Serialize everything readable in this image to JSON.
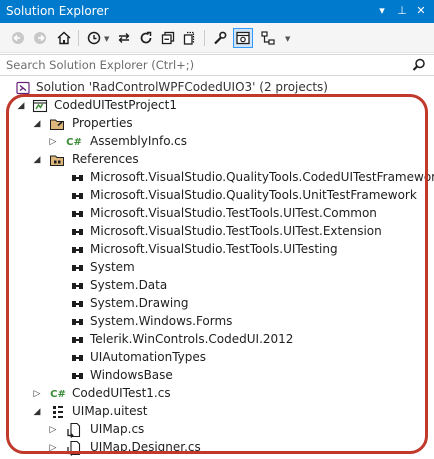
{
  "window": {
    "title": "Solution Explorer",
    "dropdown_glyph": "▾",
    "pin_glyph": "⊥",
    "close_glyph": "✕"
  },
  "toolbar": {
    "tools": [
      "back-icon",
      "forward-icon",
      "home-icon",
      "history-icon",
      "sync-icon",
      "refresh-icon",
      "collapse-all-icon",
      "show-all-files-icon",
      "properties-icon",
      "preview-icon",
      "class-diagram-icon"
    ],
    "active_tool": "preview-icon"
  },
  "search": {
    "placeholder": "Search Solution Explorer (Ctrl+;)"
  },
  "tree": {
    "solution": "Solution 'RadControlWPFCodedUIO3' (2 projects)",
    "project": "CodedUITestProject1",
    "properties": "Properties",
    "assemblyinfo": "AssemblyInfo.cs",
    "references": "References",
    "refs": [
      "Microsoft.VisualStudio.QualityTools.CodedUITestFramework",
      "Microsoft.VisualStudio.QualityTools.UnitTestFramework",
      "Microsoft.VisualStudio.TestTools.UITest.Common",
      "Microsoft.VisualStudio.TestTools.UITest.Extension",
      "Microsoft.VisualStudio.TestTools.UITesting",
      "System",
      "System.Data",
      "System.Drawing",
      "System.Windows.Forms",
      "Telerik.WinControls.CodedUI.2012",
      "UIAutomationTypes",
      "WindowsBase"
    ],
    "codeduitest1": "CodedUITest1.cs",
    "uimap": "UIMap.uitest",
    "uimap_cs": "UIMap.cs",
    "uimap_designer": "UIMap.Designer.cs",
    "collapsed_glyph": "▷",
    "expanded_glyph": "◢",
    "csharp_badge": "C#"
  },
  "colors": {
    "titlebar": "#007acc",
    "highlight": "#c0392b",
    "folder": "#dcb67a",
    "csharp": "#388a34",
    "project": "#68217a"
  }
}
